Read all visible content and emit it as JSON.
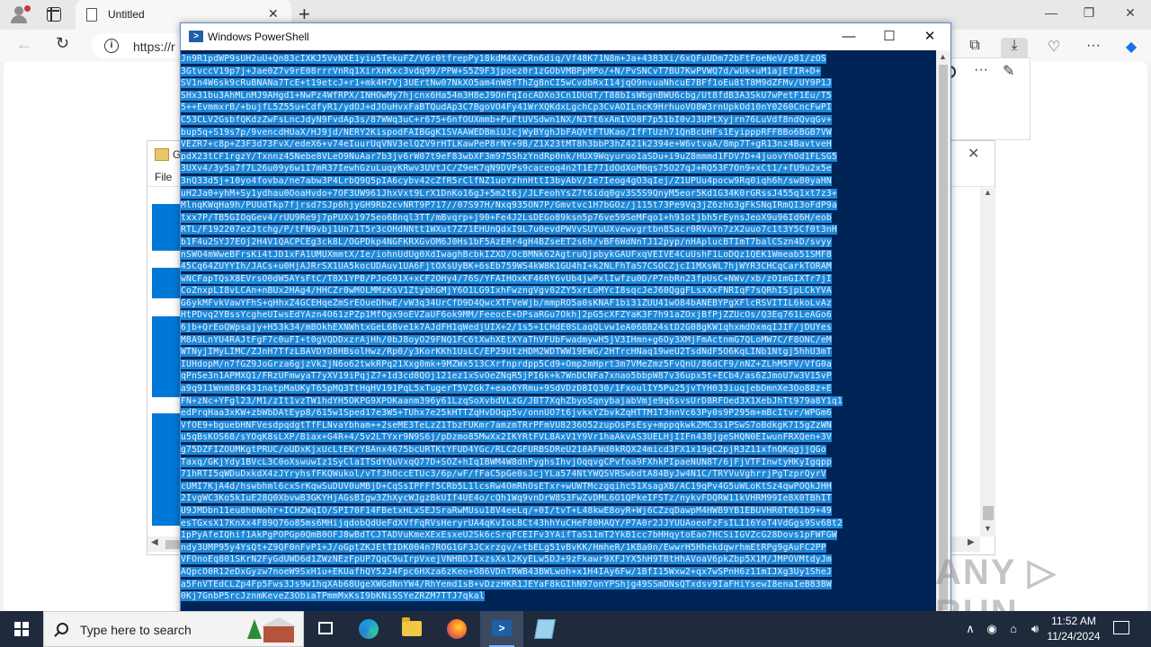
{
  "edge": {
    "tab_title": "Untitled",
    "tab_close": "✕",
    "new_tab": "+",
    "minimize": "—",
    "restore": "❐",
    "close": "✕",
    "back": "←",
    "refresh": "↻",
    "address_prefix": "https://r",
    "info_glyph": "i",
    "toolbar_icons": [
      "collections-icon",
      "download-icon",
      "performance-icon",
      "more-icon",
      "copilot-icon"
    ],
    "toolbar_glyphs": [
      "⧉",
      "⤓",
      "♡",
      "···",
      "◆"
    ],
    "panel_more": "···",
    "panel_pin": "✎"
  },
  "explorer": {
    "title": "G",
    "close": "✕",
    "menu_file": "File"
  },
  "powershell": {
    "title": "Windows PowerShell",
    "icon_glyph": ">",
    "minimize": "—",
    "maximize": "☐",
    "close": "✕",
    "console_lines": [
      "Jn9R1pdWP9sUH2uU+Qn83cIXKJ5VvNXE1yiu5TekuFZ/V6r0tfrepPy18kdM4XvCRn6diq/Vf48K71N8m+Ja+4383Xi/6xQFuUDm72bFtFoeNeV/p81/zOS",
      "3GtvccV19p7j+Jae0Z7v9rE08rrrVnRq1XirXnKxc3vdq99/PPW+S5Z9F3jpoez0r1zGObVMBPpMPo/+N/PvSNCvT7BU7KwPVWQ7d/wUk+uM1ajEfIR+D+",
      "SV1n4W6sk9cRuBNANa7TcE+t19etcJ+r1+mk4H7Vj3UErtNw07NkXO5am4nW8fThZg8nCI5wCvdbRxI14jqO9nvuaNhcuE7BFf1oEu8tT8M9dZFMv/UY9P1J",
      "SHx31bu3AhMLnMJ9AHgd1+NwPz4WfRPX/INHOwMy7hjcnx6Ha54m3H8eJ9OnFqIocADXo3Cn1DUdT/T88bIsWbgnBWU6cbg/Ut8fdB3A3SkU7wPetF1Eu/T5",
      "5++EvmmxrB/+bujfL5Z55u+CdfyR1/ydOJ+dJOuHvxFaBTQudAp3C7BgoVO4Fy41WrXQKdxLgchCp3CvAOILncK9HrhuoVO8W3rnUpkOd10nY0260CncFwPI",
      "C53CLV2GsbfQKdzZwFsLncJdyN9FvdAp3s/87WWq3uC+r675+6nfOUXmmb+PuFtUVSdwn1NX/N3Tt6xAmIVO8F7p51bI0vJ3UPtXyjrn76LuVdf8ndQvqGv+",
      "bup5q+S19s7p/9vencdHUaX/HJ9jd/NERY2KispodFAIBGgK1SVAAWEDBmiUJcjWyBYghJbFAQVtFTUKao/IfFTUzh71QnBcUHFs1EyipppRFFBBo6BGB7VW",
      "VEZR7+c8p+Z3F3d73FvX/edeX6+v74eIuurUqVNV3elQZV9rHTLKawPeP8rNY+9B/Z1X23tMT8h3bbP3hZ421k2394e+W6vtvaA/8mp7T+gR13nz4BavtveH",
      "pdX23tCF1rgzY/Txnnz45Nebe8VLeO9NuAar7b3jv6rW07t9eF83wbXF3m975ShzYndRp0nk/HUX9Wqyuruo1aSDu+i9uZ8mmmd1FDV7D+4juovYhOd1FLSG5",
      "3UXv4/3y5a7f7L26u09y6w1I7mR37IewhGzuLuqyKRwv3UVtJC/Z9eK7qN9DVPs9caceoq4n2T1E771dOdXoM0qs75O27qJ+RQ53F7On9+xCt1/+fU9u2x5e",
      "3nQ33d5j+10yo4fovba/ne7abw3P4LrbQ9Q5pIA6cybv42cZfR5rClfNZ1uoYzhnHttI3byAbV/Ie7Ieog4gO3qIej/Z1UPUu4pocw9Rq0iqh6h/sw80yaHN",
      "uH2Ja0+yhM+Sy1ydhau0OoaHvdo+7OF3UW961JhxVxt9LrX1DnKo16gJ+5m2t6j/JLFeohYsZ7t6idq0gv3S5S9QnyM5eor5Kd1G34K0rGRssJ455q1xt7z3+",
      "MlnqKWqHa9h/PUUdTkp7fjrsd7SJp6hjyGH9Rb2cvNRT9P717//07S97H/Nxq935ON7P/Gmvtvc1H7bGOz/j115t73Pe9Vq3jZ6zh63gFkSNqIRmQI3oFdP9a",
      "txx7P/TB5GIOqGev4/rUU9Re9j7pPUXv1975eo6Bnql3TT/mBvqrp+j90+Fe4J2LsDEGo89ksn5p76ve59SeMFqo1+h91otjbh5rEynsJeoX9u96Id6H/eob",
      "RTL/F192207ezJtchg/P/tFN9vbj1Un71T5r3cOHdNNtt1WXut7Z71EHUnQdxI9L7u0evdPWVvSUYuUXvewvgrtbn8Sacr0RVuYn7zX2uuo7c1t3Y5Cf0t3nH",
      "b1F4u2SYJ7EOj2H4V1QACPCEg3ck8L/OGPDkp4NGFKRXGvOM6J0Hs1bF5AzERr4gH4BZseET2s6h/vBF6WdNnTJ12pyp/nHAplucBTImT7balCSzn4D/svyy",
      "nSWO4mWweBFrsKi4tJD1xFA1UMUXmmtX/Ie/iohnUdUg0XdIwaghBcbkIZXD/OcBMNk62AgtruQjpbykGAUFxqVEIVE4CuUshF1LoDQz1QEK1Wmeab51SMF8",
      "45Cq64ZUYYIh/JACs+u0HjAJRrSX1UA5kocUDAuv1UA6FjtOXsUyBK+6sEb759WS4kW8K1GU4hI+k2NLFhTaS7CSOCZjcI1MXsWL7hjWYR3CHCqCarkTORAM",
      "wNCFapTQsX8EVrsO0dW5AYsFtC/T8X1YPB/PJoG91X+xCF2OHy4/76S/YFAIHOxKF46RY6vUb4jwPxlIwfzu0D/P7nbRn23fpUsC+NWv/xb/zO1mGIXTr7jI",
      "CoZnxpLI8vLCAn+nBUx2HAg4/HHCZr0wMOLMMzKsV1ZtybhGMjY6O1LG9IxhFwzngVgv02ZY5xrLoMYcI8sqcJeJ60QggFLsxXxFNRIqF7sQRhISjpLCkYVA",
      "G6ykMFvkVawYFhS+qHhxZ4GCEHqeZmSrEOueDhwE/vW3q34UrCfD9D4QwcXTFVeWjb/mmpRO5a0sKNAF1bi31ZUU41wO84bANEBYPgXFlcRSVITIL6koLvAz",
      "HtPDvq2YBssYcgheUIwsEdYAzn4O61zPZp1MfOgx9oEVZaUF6ok9MM/FeeocE+DPsaRGu7Okh]2pG5cXFZYaK3F7h91aZOxjBfPjZZUcOs/Q3Eq761LeAGo6",
      "6jb+QrEoQWpsajy+H53k34/mBOkhEXNWhtxGeL6Bve1k7AJdFH1qWedjUIX+2/1s5+1CHdE0SLaqQLvw1eA06BB24stD2G08gKW1qhxmdOxmqIJIF/jDUYes",
      "M8A9LnYU4RAJtFgF7c0uFI+t0gVQDDxzrAjHh/0bJ8oyO29FNQ1FC6tXwhXEtXYaThVFUbFwadmywH5jV3IHmn+g6Oy3XMjFmActnmG7QLoMW7C/F8ONC/eM",
      "WTNyjIMyLIMC/ZJnH7TfzLBAVDYD8HBsolHwz/Rp0/y3KorKKh1UsLC/EP29UtzHDM2WDTWW19EWG/2HTrcHNaq19weU2TsdNdF5O6KqLINb1Ntgj5hhU3mT",
      "IUHdopM/n7fGZ9JoGrza6gjzVk2jN6o62twkRPq21Xxg0mk+9MZWx513CXrfnprdpp5Cd9+Omp2mHprt3m7VMeZmz5FvQnU/86dCF9/nNZ+ZLhM5FV/VfG0a",
      "qPnSe3n1APMXQ1/FRzUFmwyaT7yXV19iPqjZ7+1d3cd8QOj121ez1xSvOeZNqR5jPI6k+k7WnDCNFa7xnao5bbpW87v36upx5t+ECb4/as6ZJmoU7w3V15vP",
      "a9q911Wnm88K431natpMaUKyT65pMQ3TtHqHV191PqL5xTugerT5V2Gk7+eao6YRmu+9SdVDzD8IQ30/1FxoulIY5Pu25jvTYH033iuqjebDmnXe3Oo88z+E",
      "FN+zNc+YFgl23/M1/zIt1vzTW1hdYH5OKPG9XPOKaanm396y61LzqSoXvbdVLzG/JBT7XqhZbyoSqnybajabVmje9q6svsUrD8RFOed3X1XebJhTt979a8Y1q1",
      "edPrqHaa3xKW+zbWbDAtEyp8/615w1Sped17e3W5+TUhx7e25kHTTZqHvDOqp5v/onnUO7t6jvkxYZbvkZqHTTM1T3nnVc63Py0s9P295m+mBcItvr/WPGm6",
      "VfOE9+bguebHNFVesdpqdgtTfFLNvaYbham++2seME3TeLzZ1TbzFUKmr7amzmTRrPFmVU8236O52zupOsPsEsy+mppqkwkZMC3s1PSwS7oBdkgK7I5gZzWN",
      "u5qBsKOS68/sYOqK8sLXP/Biax+G4R+4/5v2LTYxr9N9S6j/pDzmo85MwXx2IKYRtFVL8AxV1Y9Vr1haAkvAS3UELHjIIFn438jgeSHQN0EIwunFRXQen+3V",
      "g75DZFIZOUMKgtPRUC/oUDxKjxUcLtEKrY8Anx4675bcURTKtYFUD4YGc/RLC2GFURBSDReU210AFWd0kRQX24micd3FX1x19gC2pjR3Z11xfnQKqgjjQGo",
      "Taxq/GKjYdy1BVcL3C0oXswuwIz1SyClaITSdYQuVxqQ77D+SOZ+hIqIBWM4W8dhPyghsIhvjOqqvgCPvfoa9FXhkPIpaeNUN8T/6jFjVTFInwtyHKyIgqpp",
      "71hRTI5qWDuDxkdX4zJYryhsfFKQWukol/vTf3hOccETUc3/6p/wF/fFaC5pGe0sJcjYLa574NtYWQSVRSwbdtA84ByJw4N1C/TRYVuVghrrjPgTzprQyrV",
      "cUMI7KjA4d/hswbhml6cxSrKqwSuDUV0uMBjD+CqSsIPFFf5CRb5L1lcsRw4OmRhOsETxr+wUWTMczgqihc51XsagXB/AC19qPv4G5uWLoKtSz4qwPOQkJHH",
      "2IvgWC3Ko5kIuE28Q0XbvwB3GKYHjAGsBIgw3ZhXycWJgzBkUIf4UE4o/cQh1Wq9vnDrW8S3FwZvDML6O1QPkeIFSTz/nykvFDQRW11kVHRM99Ie8X0TBhIT",
      "U9JMDbn11eu8h0Nohr+ICHZWqIO/SPI70F14FBetxHLxSEJSraRwMUsu18V4eeLq/+0I/tvT+L48kwE8oyR+Wj6CZzqDawpM4HWB9YB1EBUVHR0T061b9+49",
      "esTGxsX17KnXx4F89Q76o85ms6MHijqdobQdUeFdXVfFqRVsHeryrUA4qKvIoL8Ct43hhYuCHeF80HAQY/P7A0r2JJYUUAoeoFzFsILI16YoT4VdGgs9Sv68t2",
      "1pPyAfeIQhif1AkPgPOPGp0QmB0OFJ8wBdTCJTADVuKmeXExEsxeU2Sk6cSrqFCEIFv3YAifTaS11mT2YkB1cc7bHHqytoEao7HCSiIGVZcG28Dovs1pFWFGW",
      "ndy3UMP95y4YsQt+Z9QF0nFvP1+J/oGptZKJEtTIDK004n7ROG1GF3JCxrzgv/+tbELg51vBvKK/HmheR/1KBa0n/EwwrH5HhekdqwrhmEtRPg9gAuFC2PP",
      "VFOnoEq801SKrN2FyGdUWD6d1ZWzNEzFpUP7QqC9uIrpVxejVNHBDJIxzsXxl2KyELw5DJ+9zFkawr9XFJYX5hH9TBtHhAVoaV6pkZbp5X1M/JMPOVMtdyJm",
      "AQpcO0R12eDxGyzw7noeW9SxH1u+EKUafhQY52J4Fpc6HXza6zKeo+O86VDnTRWB43BWLwoh+x1H4IAy6Fw/1BfI15Wxw2+qx7wSPnH6z11mIJXg3Uy1SheJ",
      "a5FnVTEdCLZp4Fp5Fws3Js9w1hqXAb68UgeXWGdNnYW4/RhYemd1sB+vDzzHKR1JEYaF8kGIhN97onYPShjg49SSmDNsQTxdsv9IaFHiYsewI8enaIeB83BW",
      "0Kj7GnbP5rcJznmKeveZ3ObiaTPmmMxKsI9bKNiSSYeZRZM7TTJ7qkal"
    ]
  },
  "watermark": "ANY ▷ RUN",
  "taskbar": {
    "search_placeholder": "Type here to search",
    "time": "11:52 AM",
    "date": "11/24/2024",
    "tray_chevron": "∧",
    "tray_icons": [
      "shield-icon",
      "network-icon",
      "volume-icon"
    ],
    "tray_glyphs": [
      "◉",
      "⌂",
      "🔊︎"
    ]
  }
}
